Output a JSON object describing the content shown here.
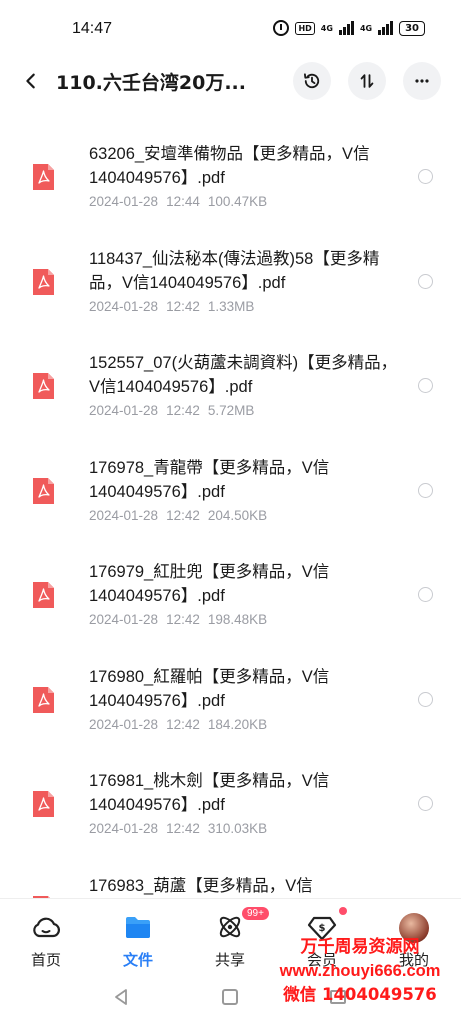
{
  "status_bar": {
    "time": "14:47",
    "hd_label": "HD",
    "network1": "4G",
    "network2": "4G",
    "battery": "30"
  },
  "header": {
    "title": "110.六壬台湾20万...",
    "back_icon": "chevron-left-icon",
    "history_icon": "history-icon",
    "sort_icon": "sort-icon",
    "more_icon": "more-horizontal-icon"
  },
  "files": [
    {
      "name": "63206_安壇準備物品【更多精品，V信1404049576】.pdf",
      "date": "2024-01-28",
      "time": "12:44",
      "size": "100.47KB"
    },
    {
      "name": "118437_仙法秘本(傳法過教)58【更多精品，V信1404049576】.pdf",
      "date": "2024-01-28",
      "time": "12:42",
      "size": "1.33MB"
    },
    {
      "name": "152557_07(火葫蘆未調資料)【更多精品，V信1404049576】.pdf",
      "date": "2024-01-28",
      "time": "12:42",
      "size": "5.72MB"
    },
    {
      "name": "176978_青龍帶【更多精品，V信1404049576】.pdf",
      "date": "2024-01-28",
      "time": "12:42",
      "size": "204.50KB"
    },
    {
      "name": "176979_紅肚兜【更多精品，V信1404049576】.pdf",
      "date": "2024-01-28",
      "time": "12:42",
      "size": "198.48KB"
    },
    {
      "name": "176980_紅羅帕【更多精品，V信1404049576】.pdf",
      "date": "2024-01-28",
      "time": "12:42",
      "size": "184.20KB"
    },
    {
      "name": "176981_桃木劍【更多精品，V信1404049576】.pdf",
      "date": "2024-01-28",
      "time": "12:42",
      "size": "310.03KB"
    },
    {
      "name": "176983_葫蘆【更多精品，V信",
      "date": "",
      "time": "",
      "size": ""
    }
  ],
  "bottom_nav": {
    "home": "首页",
    "files": "文件",
    "share": "共享",
    "share_badge": "99+",
    "vip": "会员",
    "me": "我的"
  },
  "watermark": {
    "line1": "万千周易资源网",
    "line2": "www.zhouyi666.com",
    "line3": "微信 1404049576"
  },
  "colors": {
    "accent": "#2a7ff6",
    "pdf_icon": "#f05a5a",
    "badge": "#ff4d6a",
    "watermark": "#ff1a1a",
    "meta_text": "#9a9ca3"
  }
}
